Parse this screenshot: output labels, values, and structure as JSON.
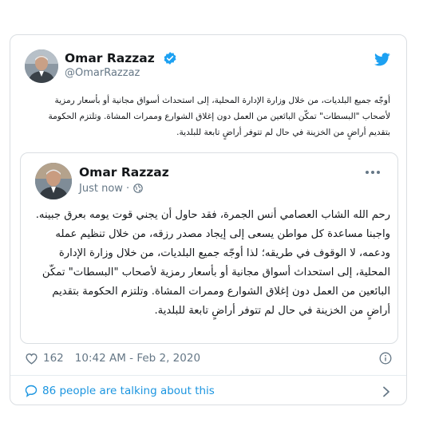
{
  "tweet": {
    "author_name": "Omar Razzaz",
    "handle": "@OmarRazzaz",
    "text": "أوجّه جميع البلديات، من خلال وزارة الإدارة المحلية، إلى استحداث أسواق مجانية أو بأسعار رمزية لأصحاب \"البسطات\" تمكّن البائعين من العمل دون إغلاق الشوارع وممرات المشاة. وتلتزم الحكومة بتقديم أراضٍ من الخزينة في حال لم تتوفر أراضٍ تابعة للبلدية.",
    "likes": "162",
    "timestamp": "10:42 AM - Feb 2, 2020",
    "talking": "86 people are talking about this"
  },
  "quoted": {
    "author_name": "Omar Razzaz",
    "time": "Just now · ",
    "text": "رحم الله الشاب العصامي أنس الجمرة، فقد حاول أن يجني قوت يومه بعرق جبينه.\nواجبنا مساعدة كل مواطن يسعى إلى إيجاد مصدر رزقه، من خلال تنظيم عمله ودعمه، لا الوقوف في طريقه؛ لذا أوجّه جميع البلديات، من خلال وزارة الإدارة المحلية، إلى استحداث أسواق مجانية أو بأسعار رمزية لأصحاب \"البسطات\" تمكّن البائعين من العمل دون إغلاق الشوارع وممرات المشاة. وتلتزم الحكومة بتقديم أراضٍ من الخزينة في حال لم تتوفر أراضٍ تابعة للبلدية."
  },
  "icons": {
    "verified": "verified-badge-icon",
    "bird": "twitter-bird-icon",
    "globe": "globe-icon",
    "more": "more-dots-icon",
    "heart": "heart-icon",
    "info": "info-icon",
    "bubble": "speech-bubble-icon",
    "chevron": "chevron-right-icon"
  },
  "colors": {
    "accent": "#1da1f2",
    "link": "#1b95e0",
    "text": "#14171a",
    "muted": "#657786",
    "border": "#dadee2"
  }
}
